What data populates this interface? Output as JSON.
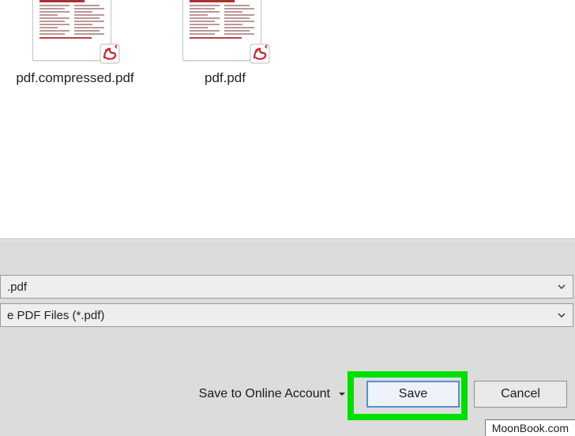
{
  "files": [
    {
      "name": "pdf.compressed.pdf"
    },
    {
      "name": "pdf.pdf"
    }
  ],
  "filename_field": ".pdf",
  "filetype_field": "e PDF Files (*.pdf)",
  "online_label": "Save to Online Account",
  "buttons": {
    "save": "Save",
    "cancel": "Cancel"
  },
  "watermark": "MoonBook.com"
}
